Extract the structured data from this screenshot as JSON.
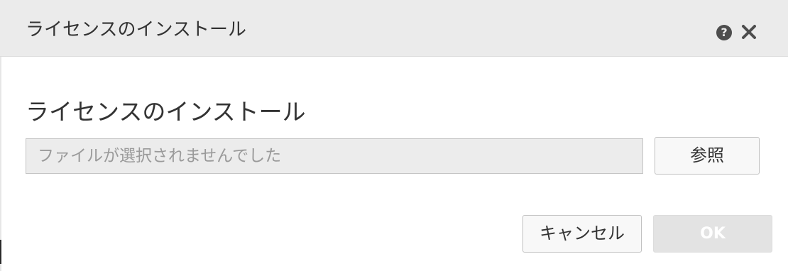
{
  "dialog": {
    "title": "ライセンスのインストール",
    "help_icon": "?",
    "close_icon": "close-icon"
  },
  "main": {
    "section_title": "ライセンスのインストール",
    "file_field": {
      "value": "",
      "placeholder": "ファイルが選択されませんでした"
    },
    "browse_label": "参照"
  },
  "footer": {
    "cancel_label": "キャンセル",
    "ok_label": "OK",
    "ok_enabled": false
  }
}
